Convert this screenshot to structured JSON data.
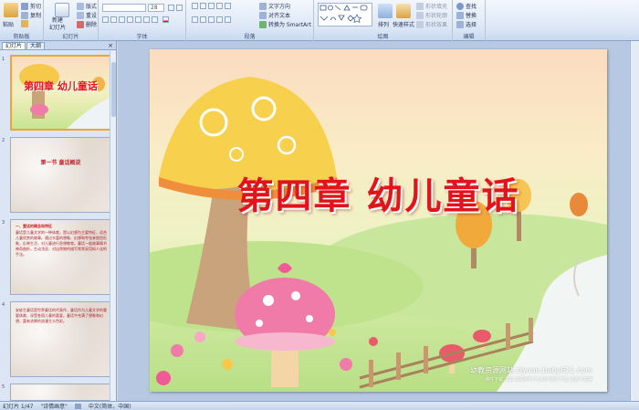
{
  "ribbon": {
    "clipboard": {
      "paste": "粘贴",
      "cut": "剪切",
      "copy": "复制",
      "format_painter": "格式刷",
      "label": "剪贴板"
    },
    "slides": {
      "new_slide": "新建",
      "new_slide2": "幻灯片",
      "layout": "版式",
      "reset": "重设",
      "delete": "删除",
      "label": "幻灯片"
    },
    "font": {
      "size": "28",
      "label": "字体"
    },
    "paragraph": {
      "text_direction": "文字方向",
      "align_text": "对齐文本",
      "smartart": "转换为 SmartArt",
      "label": "段落"
    },
    "drawing": {
      "arrange": "排列",
      "quick_styles": "快速样式",
      "shape_fill": "形状填充",
      "shape_outline": "形状轮廓",
      "shape_effects": "形状效果",
      "label": "绘图"
    },
    "editing": {
      "find": "查找",
      "replace": "替换",
      "select": "选择",
      "label": "编辑"
    }
  },
  "left_pane": {
    "tabs": [
      "幻灯片",
      "大纲"
    ],
    "close": "×",
    "slides": [
      {
        "num": "1",
        "title": "第四章 幼儿童话"
      },
      {
        "num": "2",
        "title": "第一节 童话概说"
      },
      {
        "num": "3",
        "heading": "一、童话的概念和特征",
        "body": "童话是儿童文学的一种体裁，是以幻想为主要特征，适合儿童欣赏的故事。通过丰富的想象、幻想和夸张来塑造形象，反映生活，对儿童进行思想教育。童话一般故事情节神奇曲折，生动浅显，对自然物的描写常常采用拟人化的手法。"
      },
      {
        "num": "4",
        "body": "安徒生童话是世界童话的代表作，童话作为儿童文学的重要体裁，深受各国儿童的喜爱。童话中充满了想象和幻想，富有浓厚的浪漫主义色彩。"
      },
      {
        "num": "5"
      }
    ]
  },
  "slide": {
    "title": "第四章  幼儿童话",
    "watermark_line1": "幼教资源网站 ziyuan.baby611.com",
    "watermark_line2": "课件下载 儿歌 故事MP3 FLASH课件下载 试卷下载等"
  },
  "status": {
    "slide_count": "幻灯片 1/47",
    "theme": "\"诗情画意\"",
    "language": "中文(简体，中国)"
  },
  "colors": {
    "ribbon_bg": "#dce7f6",
    "title_red": "#e3131b",
    "selection": "#f4a330"
  }
}
